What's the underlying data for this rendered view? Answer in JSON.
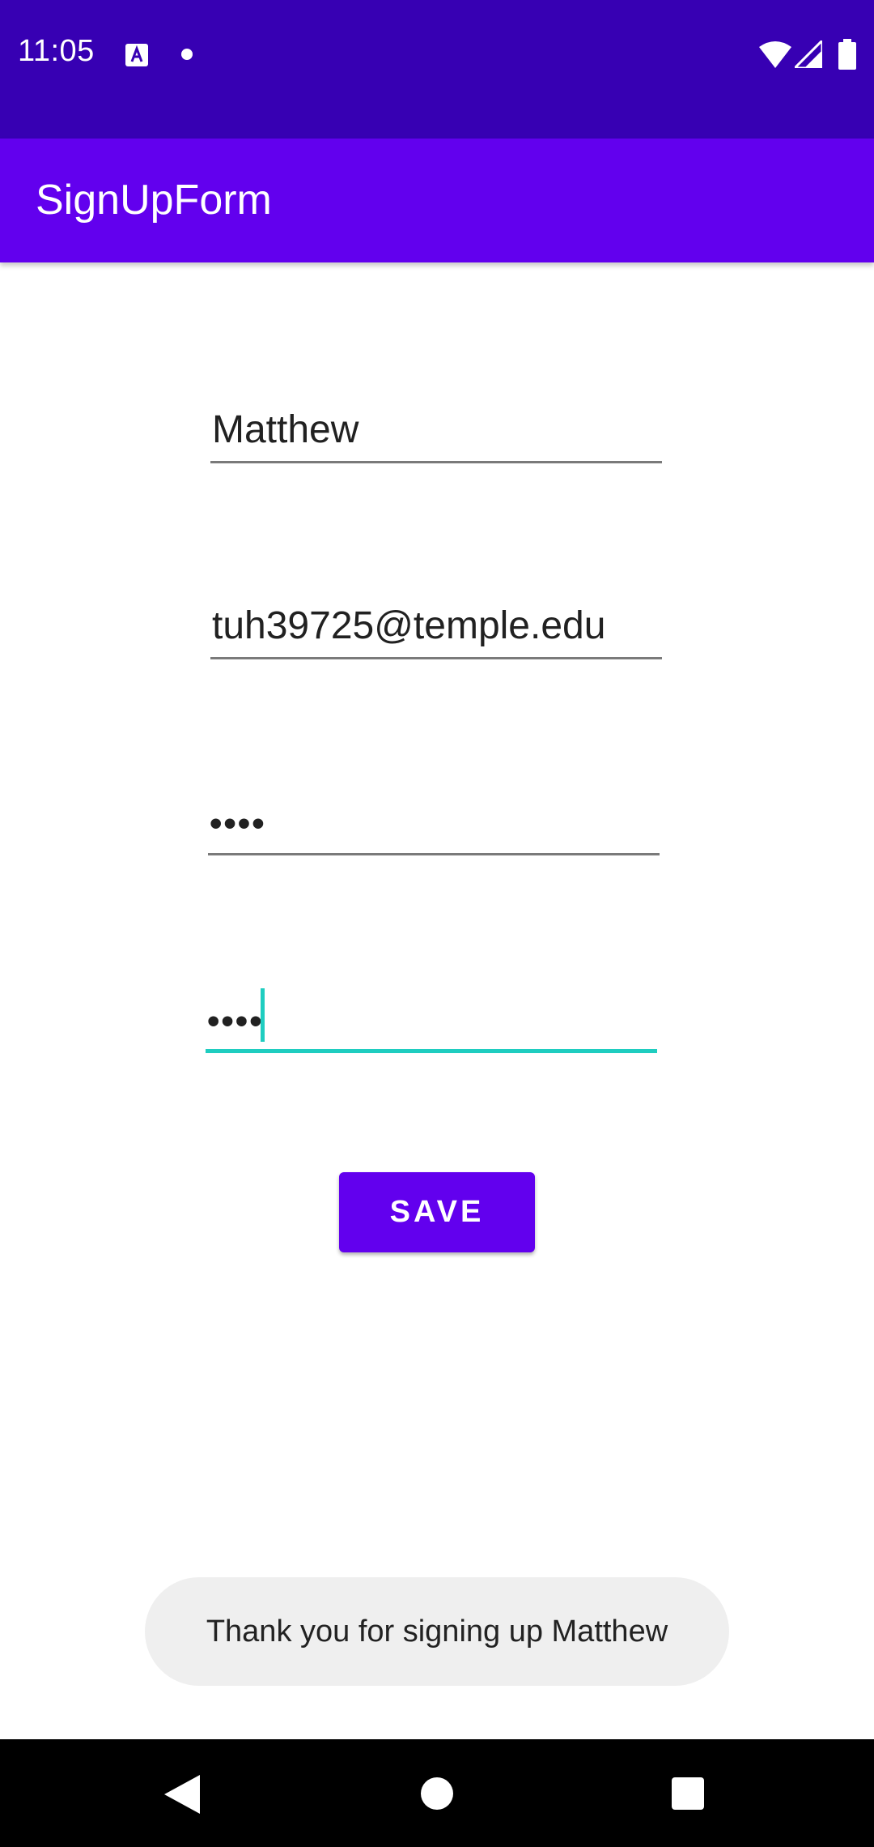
{
  "status_bar": {
    "time": "11:05",
    "icons": [
      "a-notification-icon",
      "dot-icon",
      "wifi-icon",
      "signal-icon",
      "battery-icon"
    ],
    "background": "#3700b3"
  },
  "app_bar": {
    "title": "SignUpForm",
    "background": "#6200ee"
  },
  "form": {
    "name_value": "Matthew",
    "email_value": "tuh39725@temple.edu",
    "password_value": "••••",
    "confirm_password_value": "••••",
    "focus_color": "#1fcdc0"
  },
  "save_button": {
    "label": "SAVE"
  },
  "toast": {
    "message": "Thank you for signing up Matthew"
  },
  "nav_bar": {
    "icons": [
      "back-icon",
      "home-icon",
      "recents-icon"
    ]
  }
}
